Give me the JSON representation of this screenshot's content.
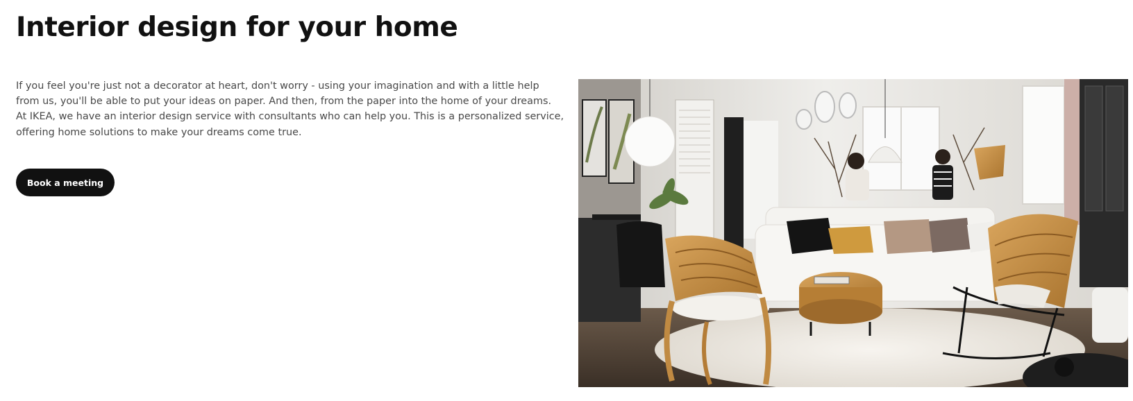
{
  "page": {
    "title": "Interior design for your home",
    "intro": "If you feel you're just not a decorator at heart, don't worry - using your imagination and with a little help from us, you'll be able to put your ideas on paper. And then, from the paper into the home of your dreams. At IKEA, we have an interior design service with consultants who can help you. This is a personalized service, offering home solutions to make your dreams come true.",
    "cta_label": "Book a meeting"
  },
  "hero": {
    "description": "living-room-photo"
  },
  "colors": {
    "cta_background": "#111111",
    "cta_text": "#ffffff",
    "body_text": "#484848",
    "heading": "#111111"
  }
}
